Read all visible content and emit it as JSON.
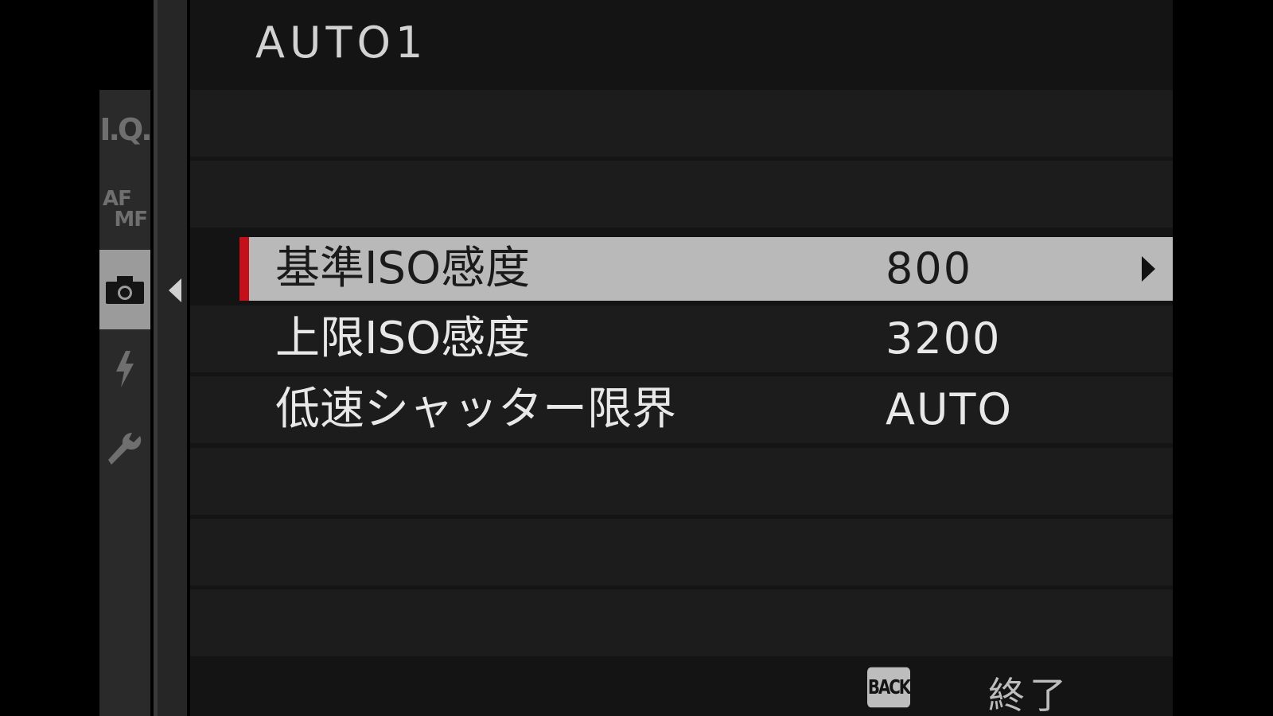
{
  "header": {
    "title": "AUTO1"
  },
  "tabs": [
    {
      "label": "I.Q.",
      "icon": "image-quality-icon",
      "active": false
    },
    {
      "label_top": "AF",
      "label_bottom": "MF",
      "icon": "af-mf-icon",
      "active": false
    },
    {
      "label": "",
      "icon": "camera-icon",
      "active": true
    },
    {
      "label": "",
      "icon": "flash-icon",
      "active": false
    },
    {
      "label": "",
      "icon": "wrench-icon",
      "active": false
    }
  ],
  "menu": {
    "items": [
      {
        "label": "基準ISO感度",
        "value": "800",
        "selected": true,
        "has_submenu": true
      },
      {
        "label": "上限ISO感度",
        "value": "3200",
        "selected": false
      },
      {
        "label": "低速シャッター限界",
        "value": "AUTO",
        "selected": false
      }
    ]
  },
  "footer": {
    "back_button": "BACK",
    "back_action": "終了"
  },
  "colors": {
    "background": "#000000",
    "panel": "#141414",
    "row": "#1c1c1c",
    "selected_row": "#b9b9b9",
    "selection_marker": "#c4101b",
    "text": "#e8e8e8"
  }
}
